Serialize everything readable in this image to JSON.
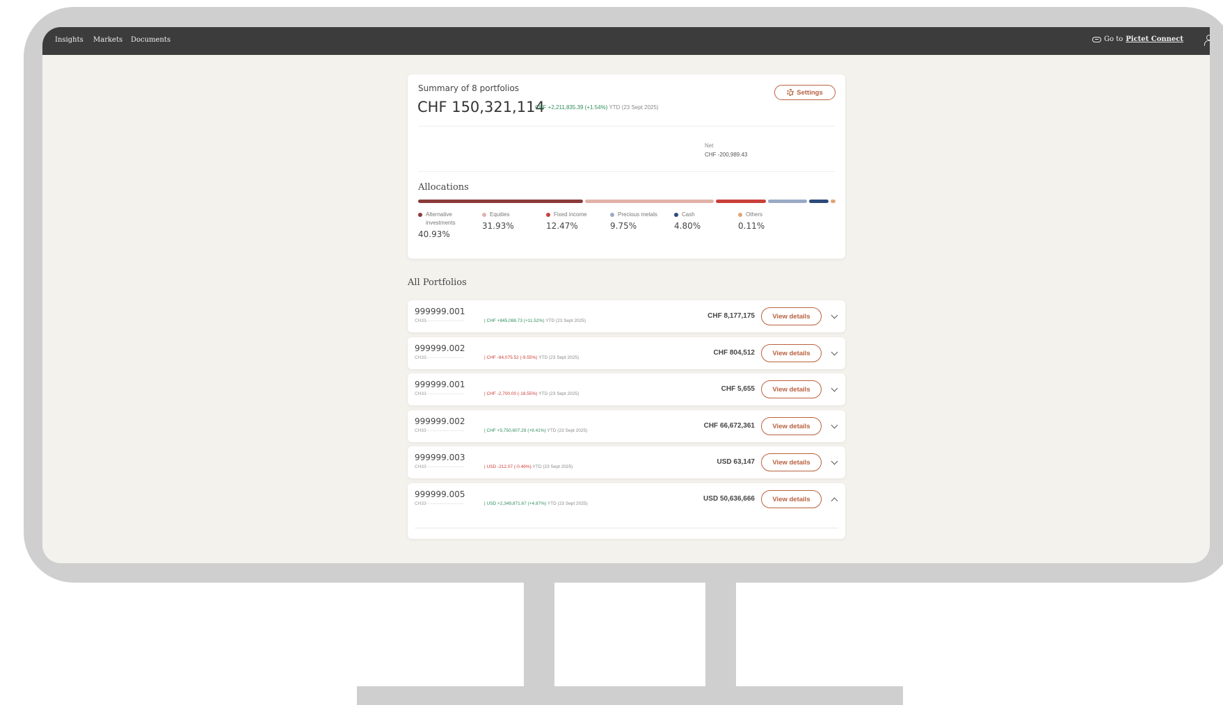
{
  "nav": {
    "items": [
      "Insights",
      "Markets",
      "Documents"
    ],
    "goto_prefix": "Go to",
    "goto_link": "Pictet Connect"
  },
  "summary": {
    "title": "Summary of 8 portfolios",
    "total": "CHF 150,321,114",
    "change": "CHF +2,211,835.39 (+1.54%)",
    "ytd": "YTD (23 Sept 2025)",
    "settings_label": "Settings",
    "net_label": "Net",
    "net_value": "CHF -200,989.43"
  },
  "allocations": {
    "title": "Allocations",
    "items": [
      {
        "label": "Alternative investments",
        "value": "40.93%",
        "share": 40.93,
        "color": "#8b3a3a"
      },
      {
        "label": "Equities",
        "value": "31.93%",
        "share": 31.93,
        "color": "#e2b2a8"
      },
      {
        "label": "Fixed income",
        "value": "12.47%",
        "share": 12.47,
        "color": "#c9403a"
      },
      {
        "label": "Precious metals",
        "value": "9.75%",
        "share": 9.75,
        "color": "#9aaac6"
      },
      {
        "label": "Cash",
        "value": "4.80%",
        "share": 4.8,
        "color": "#2d4a7a"
      },
      {
        "label": "Others",
        "value": "0.11%",
        "share": 0.11,
        "color": "#e0a47a"
      }
    ]
  },
  "portfolios": {
    "title": "All Portfolios",
    "view_label": "View details",
    "rows": [
      {
        "id": "999999.001",
        "iban": "CH33·························",
        "perf": "CHF +845,088.73 (+11.52%)",
        "trend": "pos",
        "ytd": "YTD (23 Sept 2025)",
        "amount": "CHF 8,177,175",
        "expanded": false
      },
      {
        "id": "999999.002",
        "iban": "CH33·························",
        "perf": "CHF -84,075.52 (-9.55%)",
        "trend": "neg",
        "ytd": "YTD (23 Sept 2025)",
        "amount": "CHF 804,512",
        "expanded": false
      },
      {
        "id": "999999.001",
        "iban": "CH33·························",
        "perf": "CHF -2,700.00 (-18.55%)",
        "trend": "neg",
        "ytd": "YTD (23 Sept 2025)",
        "amount": "CHF 5,655",
        "expanded": false
      },
      {
        "id": "999999.002",
        "iban": "CH33·························",
        "perf": "CHF +5,750,607.29 (+9.41%)",
        "trend": "pos",
        "ytd": "YTD (23 Sept 2025)",
        "amount": "CHF 66,672,361",
        "expanded": false
      },
      {
        "id": "999999.003",
        "iban": "CH33·························",
        "perf": "USD -212.07 (-0.46%)",
        "trend": "neg",
        "ytd": "YTD (23 Sept 2025)",
        "amount": "USD 63,147",
        "expanded": false
      },
      {
        "id": "999999.005",
        "iban": "CH33·························",
        "perf": "USD +2,349,871.67 (+4.87%)",
        "trend": "pos",
        "ytd": "YTD (23 Sept 2025)",
        "amount": "USD 50,636,666",
        "expanded": true
      }
    ]
  }
}
